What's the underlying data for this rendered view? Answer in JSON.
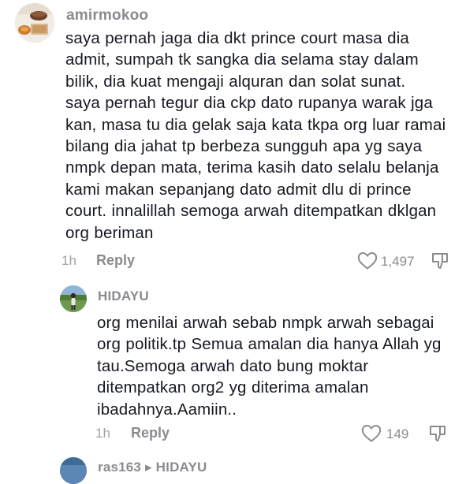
{
  "comments": [
    {
      "username": "amirmokoo",
      "lines": [
        "saya pernah jaga dia dkt prince court masa dia",
        "admit, sumpah tk sangka dia selama stay dalam",
        "bilik, dia kuat mengaji alquran dan solat sunat.",
        "saya pernah tegur dia ckp dato rupanya warak jga",
        "kan, masa tu dia gelak saja kata tkpa org luar ramai",
        "bilang dia jahat tp berbeza sungguh apa yg saya",
        "nmpk depan mata, terima kasih dato selalu belanja",
        "kami makan sepanjang dato admit dlu di prince",
        "court. innalillah semoga arwah ditempatkan dklgan",
        "org beriman"
      ],
      "time": "1h",
      "reply_label": "Reply",
      "like_count": "1,497",
      "avatar_icon": "food-photo-avatar"
    },
    {
      "username": "HIDAYU",
      "lines": [
        "org menilai arwah sebab nmpk arwah sebagai",
        "org politik.tp Semua amalan dia hanya Allah yg",
        "tau.Semoga arwah dato bung moktar",
        "ditempatkan org2 yg diterima amalan",
        "ibadahnya.Aamiin.."
      ],
      "time": "1h",
      "reply_label": "Reply",
      "like_count": "149",
      "avatar_icon": "outdoor-person-avatar"
    },
    {
      "username": "ras163 ▸ HIDAYU",
      "avatar_icon": "partial-avatar"
    }
  ],
  "colors": {
    "text": "#161823",
    "muted": "#8a8b91"
  },
  "icons": [
    "heart-icon",
    "dislike-icon"
  ]
}
